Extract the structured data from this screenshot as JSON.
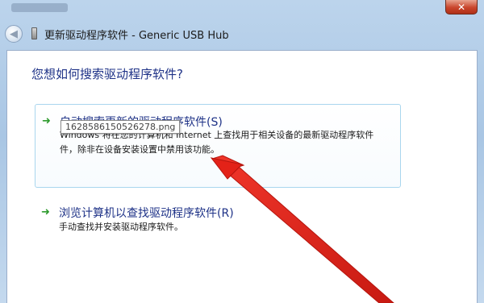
{
  "window": {
    "title": "更新驱动程序软件 - Generic USB Hub",
    "close_label": "✕"
  },
  "content": {
    "question": "您想如何搜索驱动程序软件?",
    "options": [
      {
        "title": "自动搜索更新的驱动程序软件(S)",
        "desc_line1": "Windows 将在您的计算机和 Internet 上查找用于相关设备的最新驱动程序软件",
        "desc_line2": "件，除非在设备安装设置中禁用该功能。"
      },
      {
        "title": "浏览计算机以查找驱动程序软件(R)",
        "desc_line1": "手动查找并安装驱动程序软件。"
      }
    ],
    "tooltip": "1628586150526278.png"
  },
  "colors": {
    "link_blue": "#1e3287",
    "arrow_green": "#2e9b2e",
    "annotation_red": "#e8221a",
    "option_border": "#a9d6ee"
  }
}
